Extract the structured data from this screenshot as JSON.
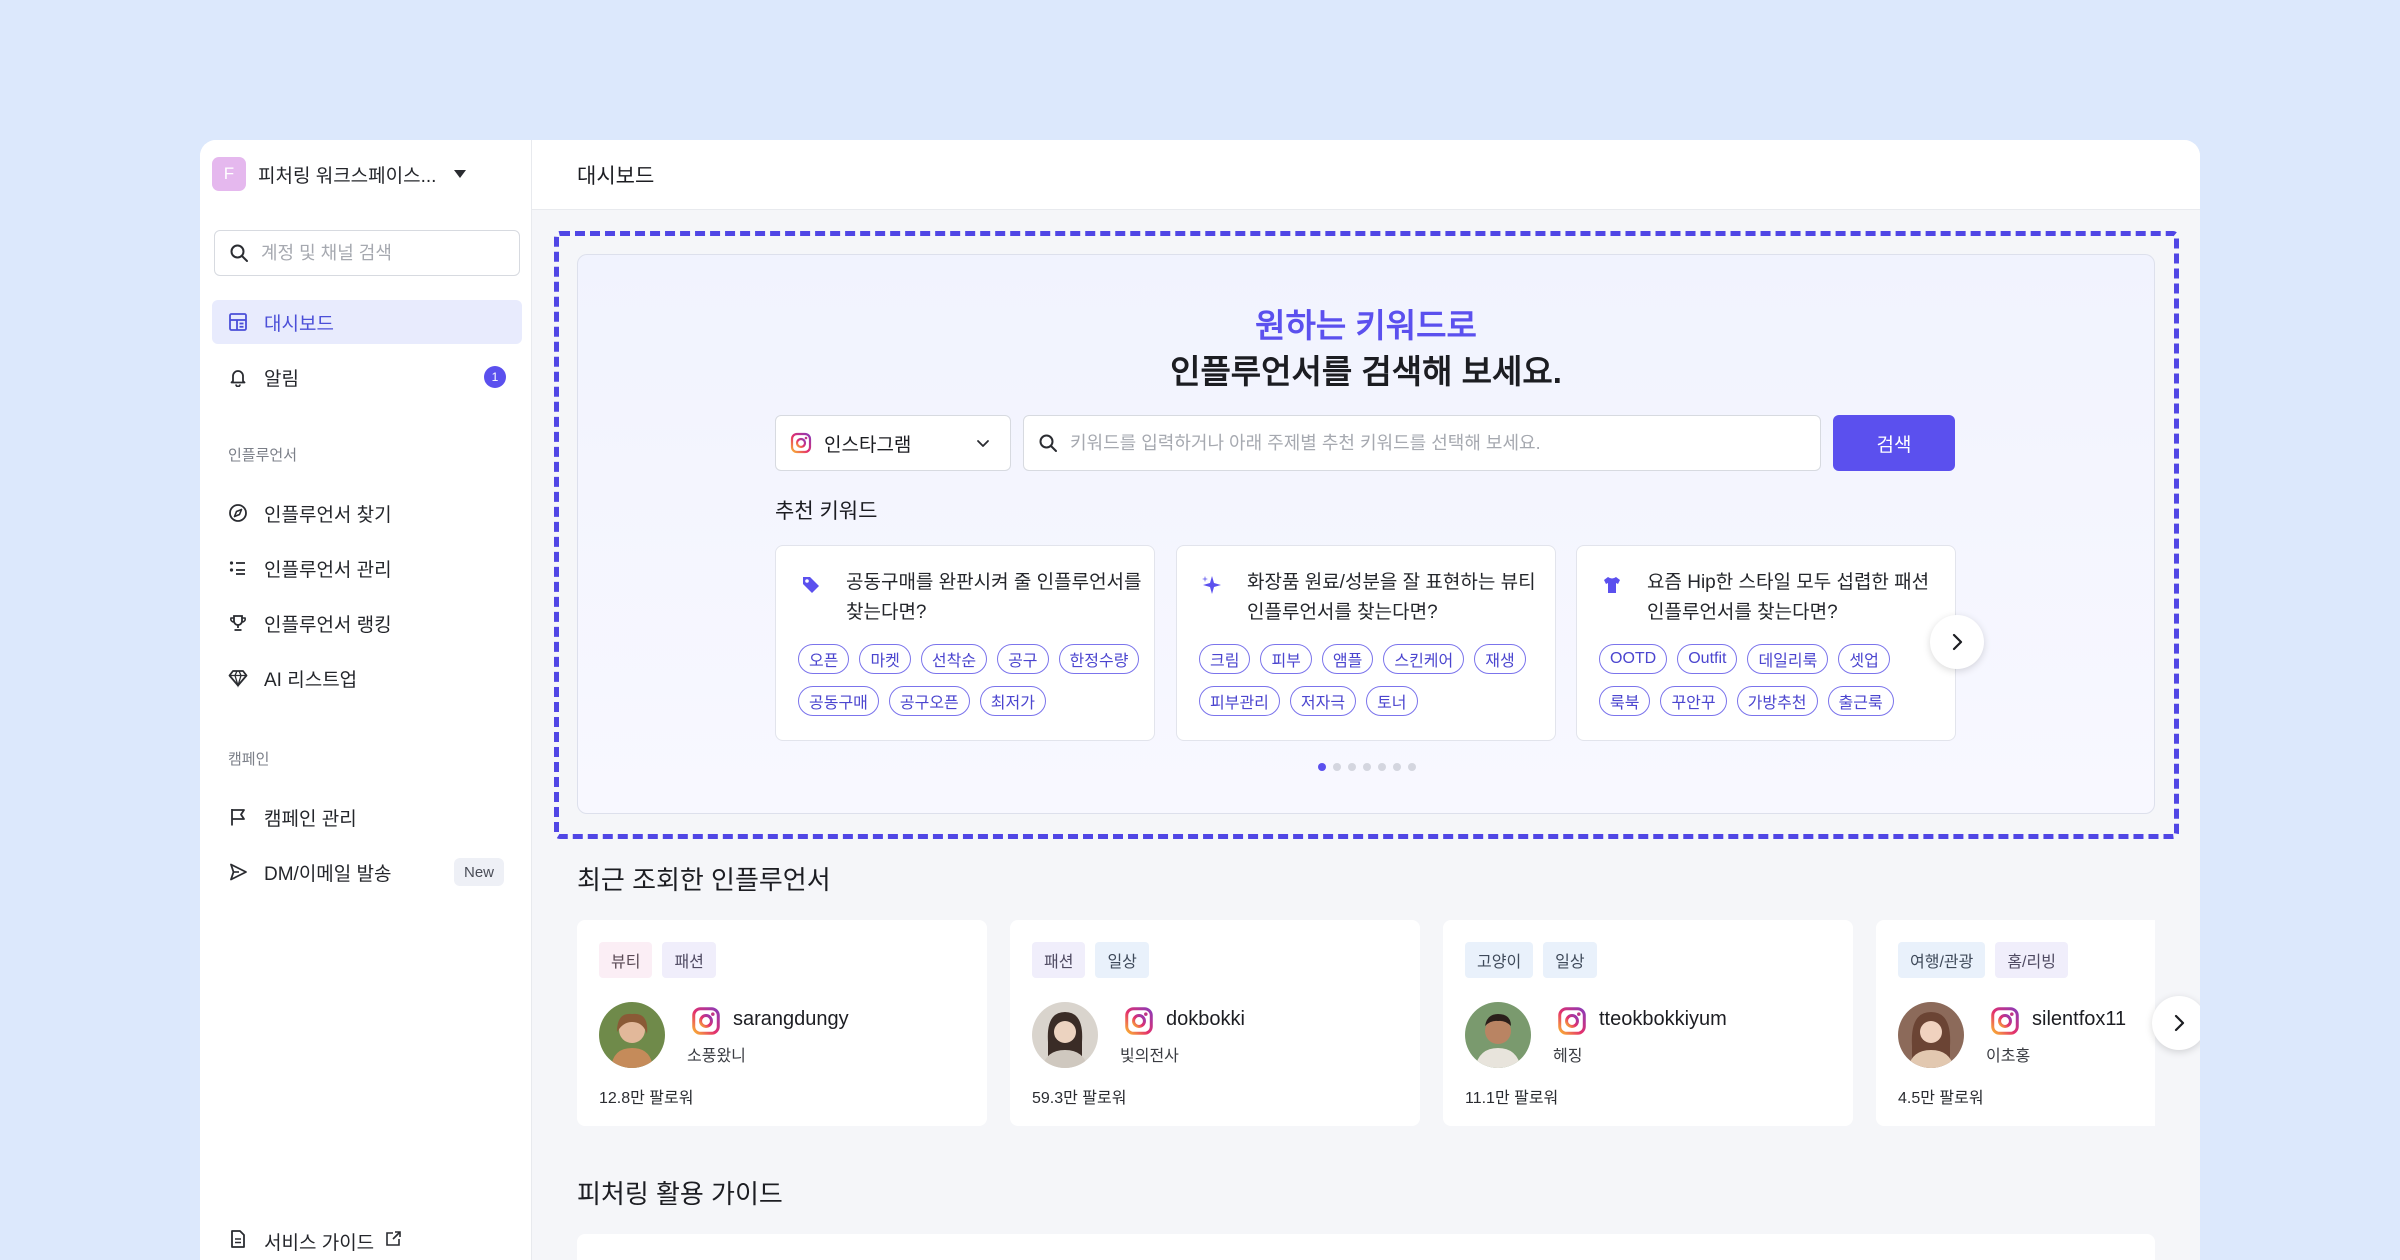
{
  "workspace": {
    "initial": "F",
    "name": "피처링 워크스페이스..."
  },
  "sidebar": {
    "search_placeholder": "계정 및 채널 검색",
    "items": [
      {
        "label": "대시보드",
        "icon": "dashboard-icon",
        "active": true
      },
      {
        "label": "알림",
        "icon": "bell-icon",
        "badge": "1"
      }
    ],
    "section_influencer": "인플루언서",
    "influencer_items": [
      {
        "label": "인플루언서 찾기",
        "icon": "compass-icon"
      },
      {
        "label": "인플루언서 관리",
        "icon": "list-icon"
      },
      {
        "label": "인플루언서 랭킹",
        "icon": "trophy-icon"
      },
      {
        "label": "AI 리스트업",
        "icon": "diamond-icon"
      }
    ],
    "section_campaign": "캠페인",
    "campaign_items": [
      {
        "label": "캠페인 관리",
        "icon": "flag-icon"
      },
      {
        "label": "DM/이메일 발송",
        "icon": "send-icon",
        "badge": "New"
      }
    ],
    "footer": {
      "label": "서비스 가이드",
      "icon": "document-icon"
    }
  },
  "header": {
    "title": "대시보드"
  },
  "hero": {
    "title_line1": "원하는 키워드로",
    "title_line2": "인플루언서를 검색해 보세요.",
    "platform": "인스타그램",
    "search_placeholder": "키워드를 입력하거나 아래 주제별 추천 키워드를 선택해 보세요.",
    "search_button": "검색",
    "recommended_title": "추천 키워드",
    "cards": [
      {
        "icon": "tag-icon",
        "question": "공동구매를 완판시켜 줄 인플루언서를 찾는다면?",
        "tags": [
          "오픈",
          "마켓",
          "선착순",
          "공구",
          "한정수량",
          "공동구매",
          "공구오픈",
          "최저가"
        ]
      },
      {
        "icon": "sparkle-icon",
        "question": "화장품 원료/성분을 잘 표현하는 뷰티 인플루언서를 찾는다면?",
        "tags": [
          "크림",
          "피부",
          "앰플",
          "스킨케어",
          "재생",
          "피부관리",
          "저자극",
          "토너"
        ]
      },
      {
        "icon": "shirt-icon",
        "question": "요즘 Hip한 스타일 모두 섭렵한 패션 인플루언서를 찾는다면?",
        "tags": [
          "OOTD",
          "Outfit",
          "데일리룩",
          "셋업",
          "룩북",
          "꾸안꾸",
          "가방추천",
          "출근룩"
        ]
      }
    ],
    "pagination_total": 7,
    "pagination_current": 1
  },
  "recent": {
    "title": "최근 조회한 인플루언서",
    "cards": [
      {
        "tags": [
          {
            "label": "뷰티",
            "color": "pink"
          },
          {
            "label": "패션",
            "color": "purple"
          }
        ],
        "handle": "sarangdungy",
        "name": "소풍왔니",
        "followers": "12.8만 팔로워"
      },
      {
        "tags": [
          {
            "label": "패션",
            "color": "purple"
          },
          {
            "label": "일상",
            "color": "blue"
          }
        ],
        "handle": "dokbokki",
        "name": "빛의전사",
        "followers": "59.3만 팔로워"
      },
      {
        "tags": [
          {
            "label": "고양이",
            "color": "blue"
          },
          {
            "label": "일상",
            "color": "blue"
          }
        ],
        "handle": "tteokbokkiyum",
        "name": "헤징",
        "followers": "11.1만 팔로워"
      },
      {
        "tags": [
          {
            "label": "여행/관광",
            "color": "blue"
          },
          {
            "label": "홈/리빙",
            "color": "purple"
          }
        ],
        "handle": "silentfox11",
        "name": "이초홍",
        "followers": "4.5만 팔로워"
      }
    ]
  },
  "guide": {
    "title": "피처링 활용 가이드"
  },
  "colors": {
    "accent": "#5b50ee",
    "dashed_border": "#5046e5",
    "background": "#dce8fc"
  }
}
